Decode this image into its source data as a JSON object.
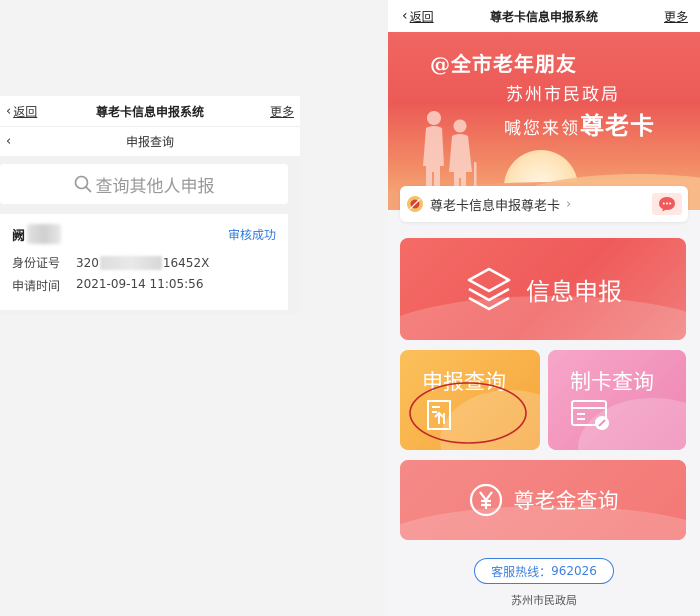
{
  "left_screen": {
    "topbar": {
      "back_label": "返回",
      "title": "尊老卡信息申报系统",
      "more_label": "更多"
    },
    "subbar": {
      "title": "申报查询"
    },
    "search": {
      "placeholder": "查询其他人申报"
    },
    "record": {
      "name": "阙",
      "status": "审核成功",
      "id_label": "身份证号",
      "id_prefix": "320",
      "id_suffix": "16452X",
      "time_label": "申请时间",
      "time_value": "2021-09-14 11:05:56"
    }
  },
  "right_screen": {
    "topbar": {
      "back_label": "返回",
      "title": "尊老卡信息申报系统",
      "more_label": "更多"
    },
    "banner": {
      "line1": "@全市老年朋友",
      "line2": "苏州市民政局",
      "line3_prefix": "喊您来领",
      "line3_highlight": "尊老卡"
    },
    "notice": {
      "text": "尊老卡信息申报尊老卡"
    },
    "buttons": {
      "info": "信息申报",
      "query": "申报查询",
      "card": "制卡查询",
      "gold": "尊老金查询"
    },
    "hotline": {
      "label": "客服热线：",
      "number": "962026"
    },
    "footer": "苏州市民政局"
  },
  "colors": {
    "accent_blue": "#2f7bd9",
    "banner_red": "#ec5a56",
    "info_red": "#ef5b5a",
    "query_orange": "#f7a53b",
    "card_pink": "#ee86b3",
    "gold_red": "#f37875",
    "annotation_red": "#c3262a"
  },
  "icons": {
    "back": "chevron-left-icon",
    "search": "search-icon",
    "layers": "layers-icon",
    "upload_doc": "upload-document-icon",
    "card_edit": "card-edit-icon",
    "yuan": "yuan-icon",
    "chat": "chat-bubble-icon",
    "notice": "emblem-icon"
  }
}
